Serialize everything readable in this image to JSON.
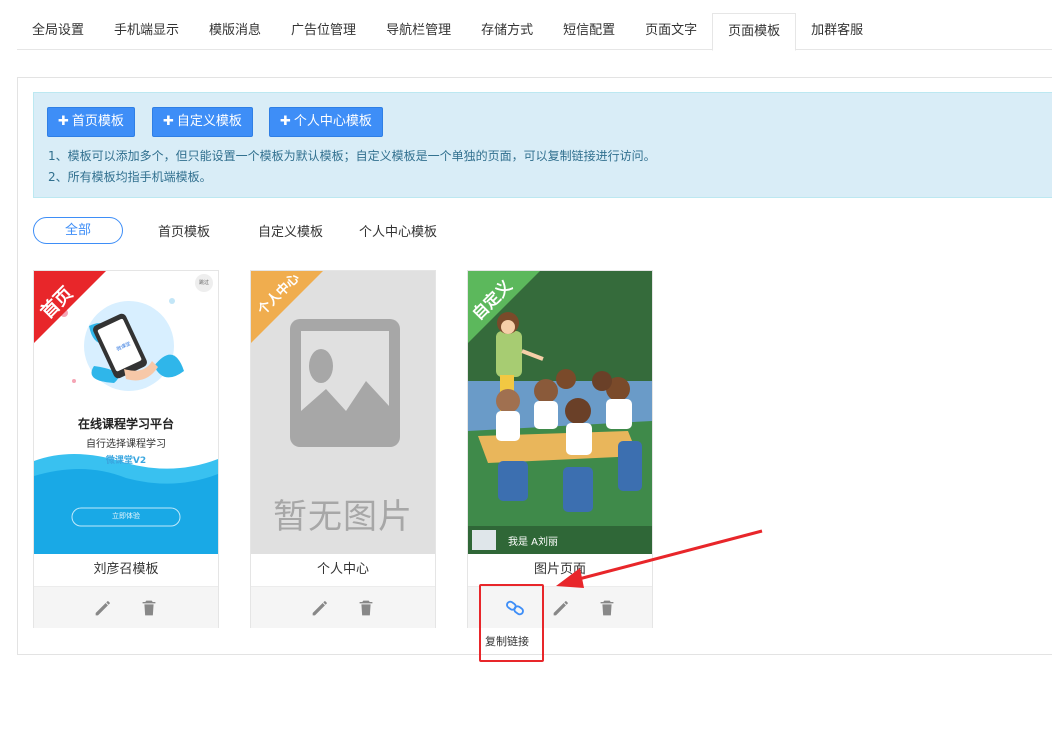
{
  "tabs": [
    "全局设置",
    "手机端显示",
    "模版消息",
    "广告位管理",
    "导航栏管理",
    "存储方式",
    "短信配置",
    "页面文字",
    "页面模板",
    "加群客服"
  ],
  "active_tab": "页面模板",
  "buttons": {
    "home": "首页模板",
    "custom": "自定义模板",
    "personal": "个人中心模板"
  },
  "notes": [
    "1、模板可以添加多个，但只能设置一个模板为默认模板；自定义模板是一个单独的页面，可以复制链接进行访问。",
    "2、所有模板均指手机端模板。"
  ],
  "filters": [
    "全部",
    "首页模板",
    "自定义模板",
    "个人中心模板"
  ],
  "cards": [
    {
      "name": "刘彦召模板",
      "ribbon": "首页",
      "ribbon_color": "#e8262a",
      "thumb_title": "在线课程学习平台",
      "thumb_subtitle": "自行选择课程学习",
      "thumb_brand": "微课堂V2",
      "thumb_button": "立即体验",
      "thumb_corner": "跳过",
      "phone_logo": "微课堂"
    },
    {
      "name": "个人中心",
      "ribbon": "个人中心",
      "ribbon_color": "#f0ad4e",
      "thumb_placeholder": "暂无图片"
    },
    {
      "name": "图片页面",
      "ribbon": "自定义",
      "ribbon_color": "#5cb85c",
      "thumb_caption": "我是 A刘丽"
    }
  ],
  "tooltip": "复制链接",
  "colors": {
    "primary": "#3e8ef7",
    "highlight": "#e8262a",
    "notice_bg": "#d9edf7",
    "icon": "#888888"
  },
  "icons": [
    "edit-icon",
    "trash-icon",
    "link-icon",
    "plus-icon"
  ]
}
